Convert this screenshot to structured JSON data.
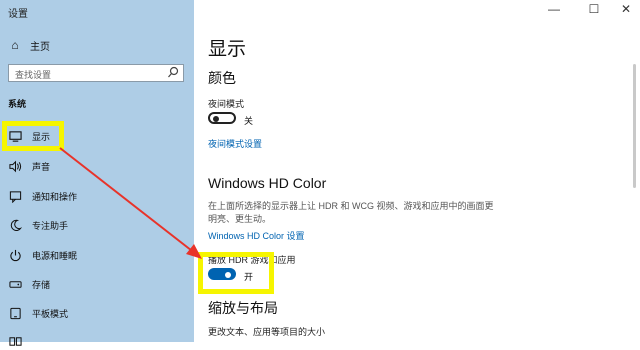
{
  "window": {
    "title": "设置",
    "minimize": "—",
    "maximize": "☐",
    "close": "✕"
  },
  "sidebar": {
    "home": {
      "label": "主页",
      "icon": "home-icon"
    },
    "search": {
      "placeholder": "查找设置",
      "icon": "search-icon"
    },
    "section": "系统",
    "items": [
      {
        "label": "显示",
        "icon": "monitor-icon",
        "selected": true
      },
      {
        "label": "声音",
        "icon": "speaker-icon"
      },
      {
        "label": "通知和操作",
        "icon": "notification-icon"
      },
      {
        "label": "专注助手",
        "icon": "moon-icon"
      },
      {
        "label": "电源和睡眠",
        "icon": "power-icon"
      },
      {
        "label": "存储",
        "icon": "storage-icon"
      },
      {
        "label": "平板模式",
        "icon": "tablet-icon"
      }
    ]
  },
  "main": {
    "title": "显示",
    "color_section": {
      "heading": "颜色",
      "night_mode_label": "夜间模式",
      "night_mode_state": "关",
      "night_mode_on": false,
      "night_mode_link": "夜间模式设置"
    },
    "hdr_section": {
      "heading": "Windows HD Color",
      "description": "在上面所选择的显示器上让 HDR 和 WCG 视频、游戏和应用中的画面更明亮、更生动。",
      "link": "Windows HD Color 设置",
      "toggle_label": "播放 HDR 游戏和应用",
      "toggle_state": "开",
      "toggle_on": true
    },
    "scale_section": {
      "heading": "缩放与布局",
      "text_size_label": "更改文本、应用等项目的大小"
    }
  },
  "colors": {
    "sidebar_bg": "#aecde6",
    "accent": "#0063b1",
    "highlight": "#f6f500",
    "arrow": "#e8332a"
  }
}
